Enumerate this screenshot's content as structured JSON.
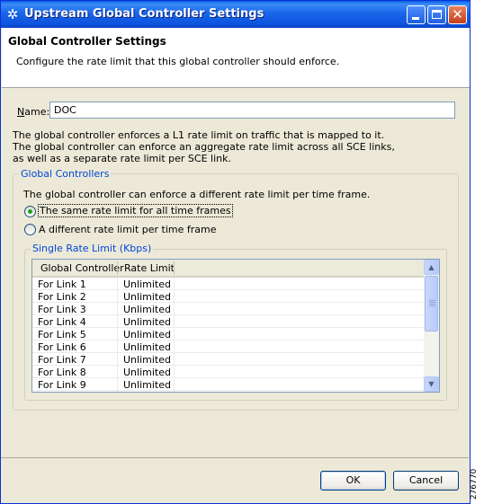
{
  "window": {
    "title": "Upstream Global Controller Settings",
    "icon": "cisco-bridge-icon"
  },
  "header": {
    "title": "Global Controller Settings",
    "description": "Configure the rate limit that this global controller should enforce."
  },
  "name_field": {
    "label_prefix": "",
    "label_underlined": "N",
    "label_rest": "ame:",
    "value": "DOC"
  },
  "description": {
    "line1": "The global controller enforces a L1 rate limit on traffic that is mapped to it.",
    "line2": "The global controller can enforce an aggregate rate limit across all SCE links,",
    "line3": "as well as a separate rate limit per SCE link."
  },
  "global_controllers": {
    "title": "Global Controllers",
    "description": "The global controller can enforce a different rate limit per time frame.",
    "options": [
      {
        "label": "The same rate limit for all time frames",
        "selected": true
      },
      {
        "label": "A different rate limit per time frame",
        "selected": false
      }
    ]
  },
  "single_rate_limit": {
    "title": "Single Rate Limit (Kbps)",
    "columns": [
      "Global Controller",
      "Rate Limit"
    ],
    "rows": [
      [
        "For Link 1",
        "Unlimited"
      ],
      [
        "For Link 2",
        "Unlimited"
      ],
      [
        "For Link 3",
        "Unlimited"
      ],
      [
        "For Link 4",
        "Unlimited"
      ],
      [
        "For Link 5",
        "Unlimited"
      ],
      [
        "For Link 6",
        "Unlimited"
      ],
      [
        "For Link 7",
        "Unlimited"
      ],
      [
        "For Link 8",
        "Unlimited"
      ],
      [
        "For Link 9",
        "Unlimited"
      ]
    ]
  },
  "buttons": {
    "ok": "OK",
    "cancel": "Cancel"
  },
  "figure_number": "276770"
}
